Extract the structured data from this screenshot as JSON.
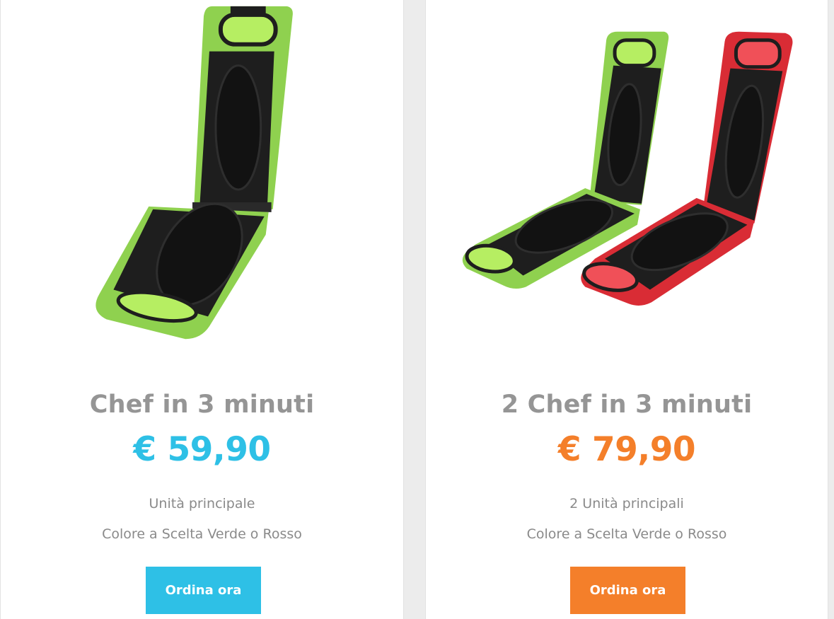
{
  "colors": {
    "blue": "#2ec0e6",
    "orange": "#f47f2a",
    "green": "#8fd14f",
    "red": "#d92c35"
  },
  "products": [
    {
      "title": "Chef in 3 minuti",
      "price": "€ 59,90",
      "features": [
        "Unità principale",
        "Colore a Scelta Verde o Rosso"
      ],
      "button_label": "Ordina ora",
      "accent": "#2ec0e6",
      "image": "green-sandwich-maker"
    },
    {
      "title": "2 Chef in 3 minuti",
      "price": "€ 79,90",
      "features": [
        "2 Unità principali",
        "Colore a Scelta Verde o Rosso"
      ],
      "button_label": "Ordina ora",
      "accent": "#f47f2a",
      "image": "green-and-red-sandwich-makers"
    }
  ]
}
